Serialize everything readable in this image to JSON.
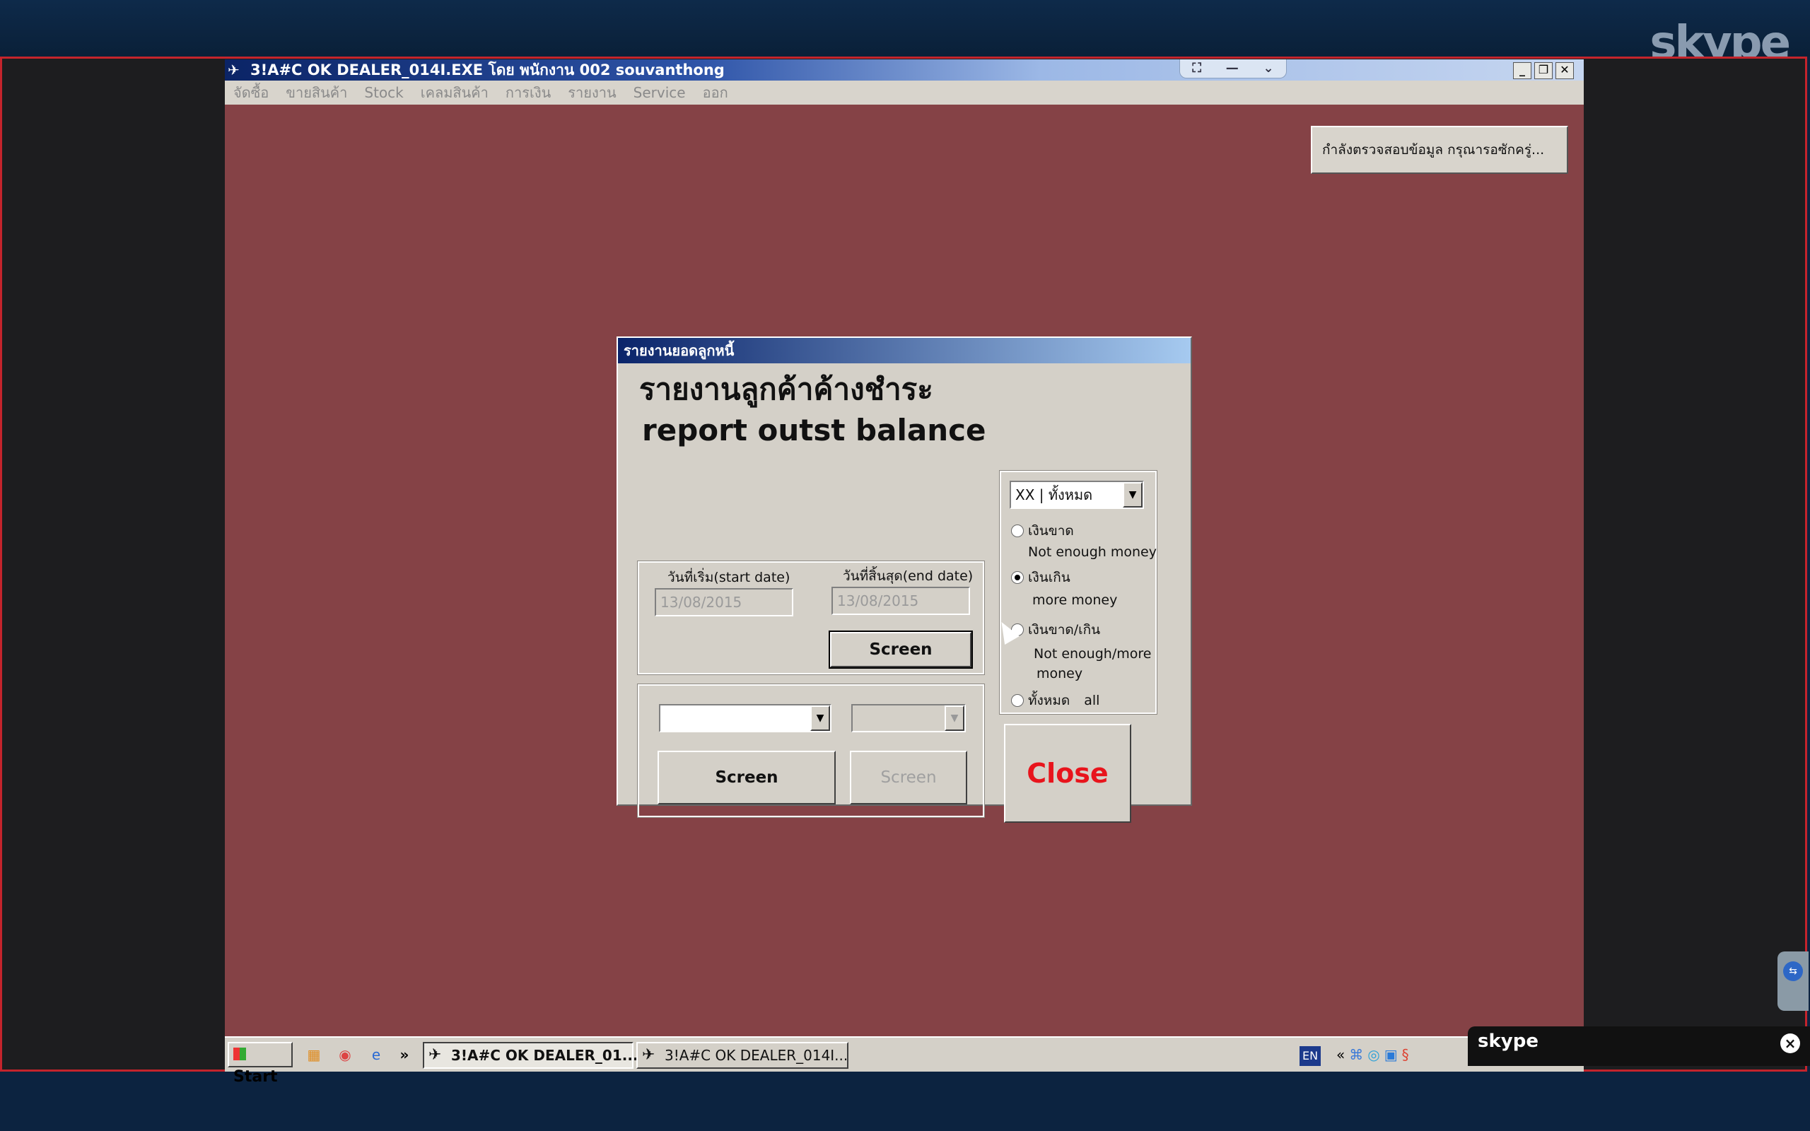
{
  "skype": {
    "logo": "skype",
    "mini_logo": "skype"
  },
  "window": {
    "title": "3!A#C OK DEALER_014I.EXE โดย พนักงาน 002 souvanthong",
    "minimize": "_",
    "restore": "❐",
    "close": "✕"
  },
  "teamviewer_bar": {
    "icons": [
      "fullscreen-icon",
      "minimize-icon",
      "chevron-down-icon"
    ]
  },
  "menu": {
    "items": [
      "จัดซื้อ",
      "ขายสินค้า",
      "Stock",
      "เคลมสินค้า",
      "การเงิน",
      "รายงาน",
      "Service",
      "ออก"
    ]
  },
  "status_message": "กำลังตรวจสอบข้อมูล กรุณารอซักครู่...",
  "dialog": {
    "title": "รายงานยอดลูกหนี้",
    "heading_th": "รายงานลูกค้าค้างชำระ",
    "heading_en": "report outst balance",
    "start_date_label": "วันที่เริ่ม(start date)",
    "end_date_label": "วันที่สิ้นสุด(end date)",
    "start_date": "13/08/2015",
    "end_date": "13/08/2015",
    "screen_label": "Screen",
    "screen_label_2": "Screen",
    "screen_label_3": "Screen",
    "combo_filter": "XX | ทั้งหมด",
    "options": [
      {
        "th": "เงินขาด",
        "en": "Not enough money",
        "checked": false
      },
      {
        "th": "เงินเกิน",
        "en": "more money",
        "checked": true
      },
      {
        "th": "เงินขาด/เกิน",
        "en": "Not enough/more",
        "en2": "money",
        "checked": false
      },
      {
        "th": "ทั้งหมด",
        "en": "all",
        "checked": false
      }
    ],
    "close_label": "Close"
  },
  "taskbar": {
    "start": "Start",
    "overflow": "»",
    "tasks": [
      "3!A#C OK DEALER_01...",
      "3!A#C OK DEALER_014I..."
    ],
    "lang": "EN",
    "tray_overflow": "«"
  },
  "colors": {
    "desktop": "#854246",
    "close_text": "#e8141c",
    "frame": "#c4242c"
  }
}
